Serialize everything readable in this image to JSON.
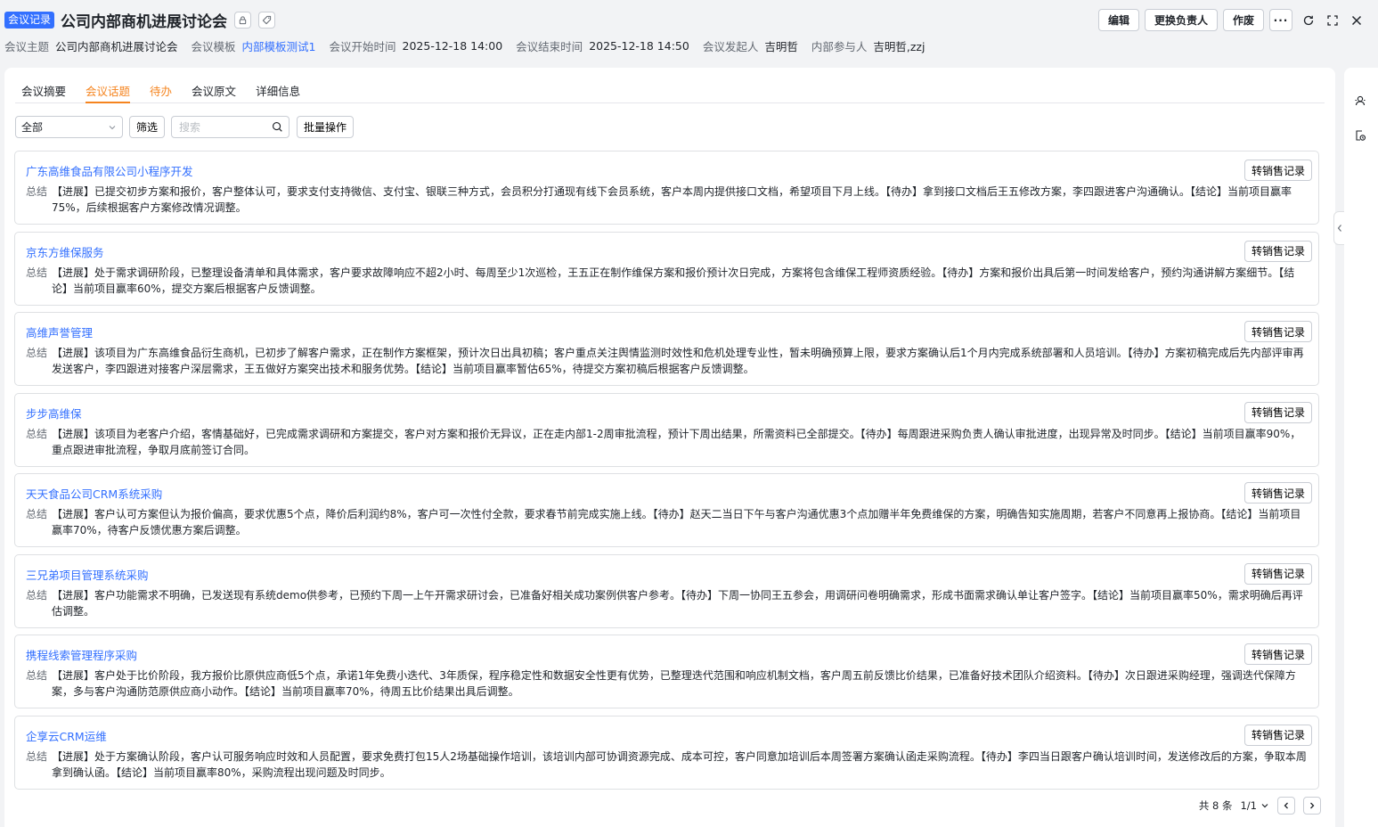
{
  "header": {
    "tag": "会议记录",
    "title": "公司内部商机进展讨论会",
    "buttons": {
      "edit": "编辑",
      "change_owner": "更换负责人",
      "void": "作废",
      "more": "···"
    }
  },
  "meta": {
    "subject_label": "会议主题",
    "subject": "公司内部商机进展讨论会",
    "template_label": "会议模板",
    "template": "内部模板测试1",
    "start_label": "会议开始时间",
    "start": "2025-12-18 14:00",
    "end_label": "会议结束时间",
    "end": "2025-12-18 14:50",
    "initiator_label": "会议发起人",
    "initiator": "吉明哲",
    "participants_label": "内部参与人",
    "participants": "吉明哲,zzj"
  },
  "tabs": [
    "会议摘要",
    "会议话题",
    "待办",
    "会议原文",
    "详细信息"
  ],
  "toolbar": {
    "select_value": "全部",
    "filter": "筛选",
    "search_placeholder": "搜索",
    "batch": "批量操作"
  },
  "card_button": "转销售记录",
  "summary_label": "总结",
  "topics": [
    {
      "title": "广东高维食品有限公司小程序开发",
      "summary": "【进展】已提交初步方案和报价，客户整体认可，要求支付支持微信、支付宝、银联三种方式，会员积分打通现有线下会员系统，客户本周内提供接口文档，希望项目下月上线。【待办】拿到接口文档后王五修改方案，李四跟进客户沟通确认。【结论】当前项目赢率75%，后续根据客户方案修改情况调整。"
    },
    {
      "title": "京东方维保服务",
      "summary": "【进展】处于需求调研阶段，已整理设备清单和具体需求，客户要求故障响应不超2小时、每周至少1次巡检，王五正在制作维保方案和报价预计次日完成，方案将包含维保工程师资质经验。【待办】方案和报价出具后第一时间发给客户，预约沟通讲解方案细节。【结论】当前项目赢率60%，提交方案后根据客户反馈调整。"
    },
    {
      "title": "高维声誉管理",
      "summary": "【进展】该项目为广东高维食品衍生商机，已初步了解客户需求，正在制作方案框架，预计次日出具初稿；客户重点关注舆情监测时效性和危机处理专业性，暂未明确预算上限，要求方案确认后1个月内完成系统部署和人员培训。【待办】方案初稿完成后先内部评审再发送客户，李四跟进对接客户深层需求，王五做好方案突出技术和服务优势。【结论】当前项目赢率暂估65%，待提交方案初稿后根据客户反馈调整。"
    },
    {
      "title": "步步高维保",
      "summary": "【进展】该项目为老客户介绍，客情基础好，已完成需求调研和方案提交，客户对方案和报价无异议，正在走内部1-2周审批流程，预计下周出结果，所需资料已全部提交。【待办】每周跟进采购负责人确认审批进度，出现异常及时同步。【结论】当前项目赢率90%，重点跟进审批流程，争取月底前签订合同。"
    },
    {
      "title": "天天食品公司CRM系统采购",
      "summary": "【进展】客户认可方案但认为报价偏高，要求优惠5个点，降价后利润约8%，客户可一次性付全款，要求春节前完成实施上线。【待办】赵天二当日下午与客户沟通优惠3个点加赠半年免费维保的方案，明确告知实施周期，若客户不同意再上报协商。【结论】当前项目赢率70%，待客户反馈优惠方案后调整。"
    },
    {
      "title": "三兄弟项目管理系统采购",
      "summary": "【进展】客户功能需求不明确，已发送现有系统demo供参考，已预约下周一上午开需求研讨会，已准备好相关成功案例供客户参考。【待办】下周一协同王五参会，用调研问卷明确需求，形成书面需求确认单让客户签字。【结论】当前项目赢率50%，需求明确后再评估调整。"
    },
    {
      "title": "携程线索管理程序采购",
      "summary": "【进展】客户处于比价阶段，我方报价比原供应商低5个点，承诺1年免费小迭代、3年质保，程序稳定性和数据安全性更有优势，已整理迭代范围和响应机制文档，客户周五前反馈比价结果，已准备好技术团队介绍资料。【待办】次日跟进采购经理，强调迭代保障方案，多与客户沟通防范原供应商小动作。【结论】当前项目赢率70%，待周五比价结果出具后调整。"
    },
    {
      "title": "企享云CRM运维",
      "summary": "【进展】处于方案确认阶段，客户认可服务响应时效和人员配置，要求免费打包15人2场基础操作培训，该培训内部可协调资源完成、成本可控，客户同意加培训后本周签署方案确认函走采购流程。【待办】李四当日跟客户确认培训时间，发送修改后的方案，争取本周拿到确认函。【结论】当前项目赢率80%，采购流程出现问题及时同步。"
    }
  ],
  "pager": {
    "total": "共 8 条",
    "page": "1/1"
  },
  "colors": {
    "accent": "#3370ff",
    "active_tab": "#f5841f"
  }
}
